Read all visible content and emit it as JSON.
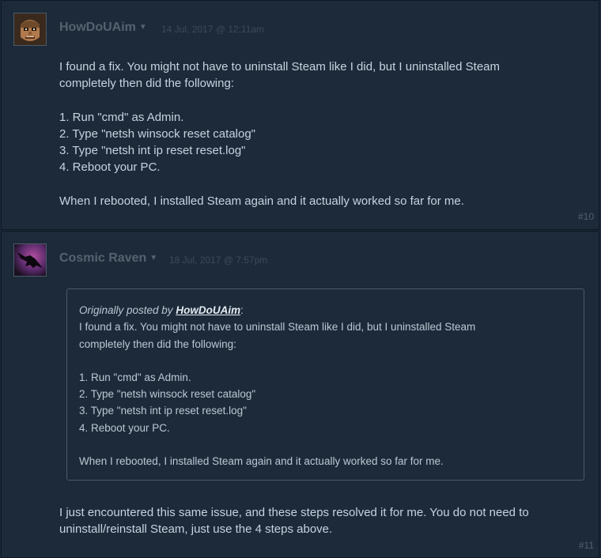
{
  "posts": [
    {
      "author": "HowDoUAim",
      "timestamp": "14 Jul, 2017 @ 12:11am",
      "number": "#10",
      "paragraphs": [
        "I found a fix. You might not have to uninstall Steam like I did, but I uninstalled Steam",
        "completely then did the following:",
        "1. Run \"cmd\" as Admin.",
        "2. Type \"netsh winsock reset catalog\"",
        "3. Type \"netsh int ip reset reset.log\"",
        "4. Reboot your PC.",
        "When I rebooted, I installed Steam again and it actually worked so far for me."
      ]
    },
    {
      "author": "Cosmic Raven",
      "timestamp": "18 Jul, 2017 @ 7:57pm",
      "number": "#11",
      "quote": {
        "prefix": "Originally posted by",
        "author": "HowDoUAim",
        "suffix": ":",
        "lines": [
          "I found a fix. You might not have to uninstall Steam like I did, but I uninstalled Steam",
          "completely then did the following:",
          "1. Run \"cmd\" as Admin.",
          "2. Type \"netsh winsock reset catalog\"",
          "3. Type \"netsh int ip reset reset.log\"",
          "4. Reboot your PC.",
          "When I rebooted, I installed Steam again and it actually worked so far for me."
        ]
      },
      "paragraphs": [
        "I just encountered this same issue, and these steps resolved it for me. You do not need to",
        "uninstall/reinstall Steam, just use the 4 steps above."
      ]
    }
  ],
  "icons": {
    "author_menu": "chevron-down-icon"
  }
}
